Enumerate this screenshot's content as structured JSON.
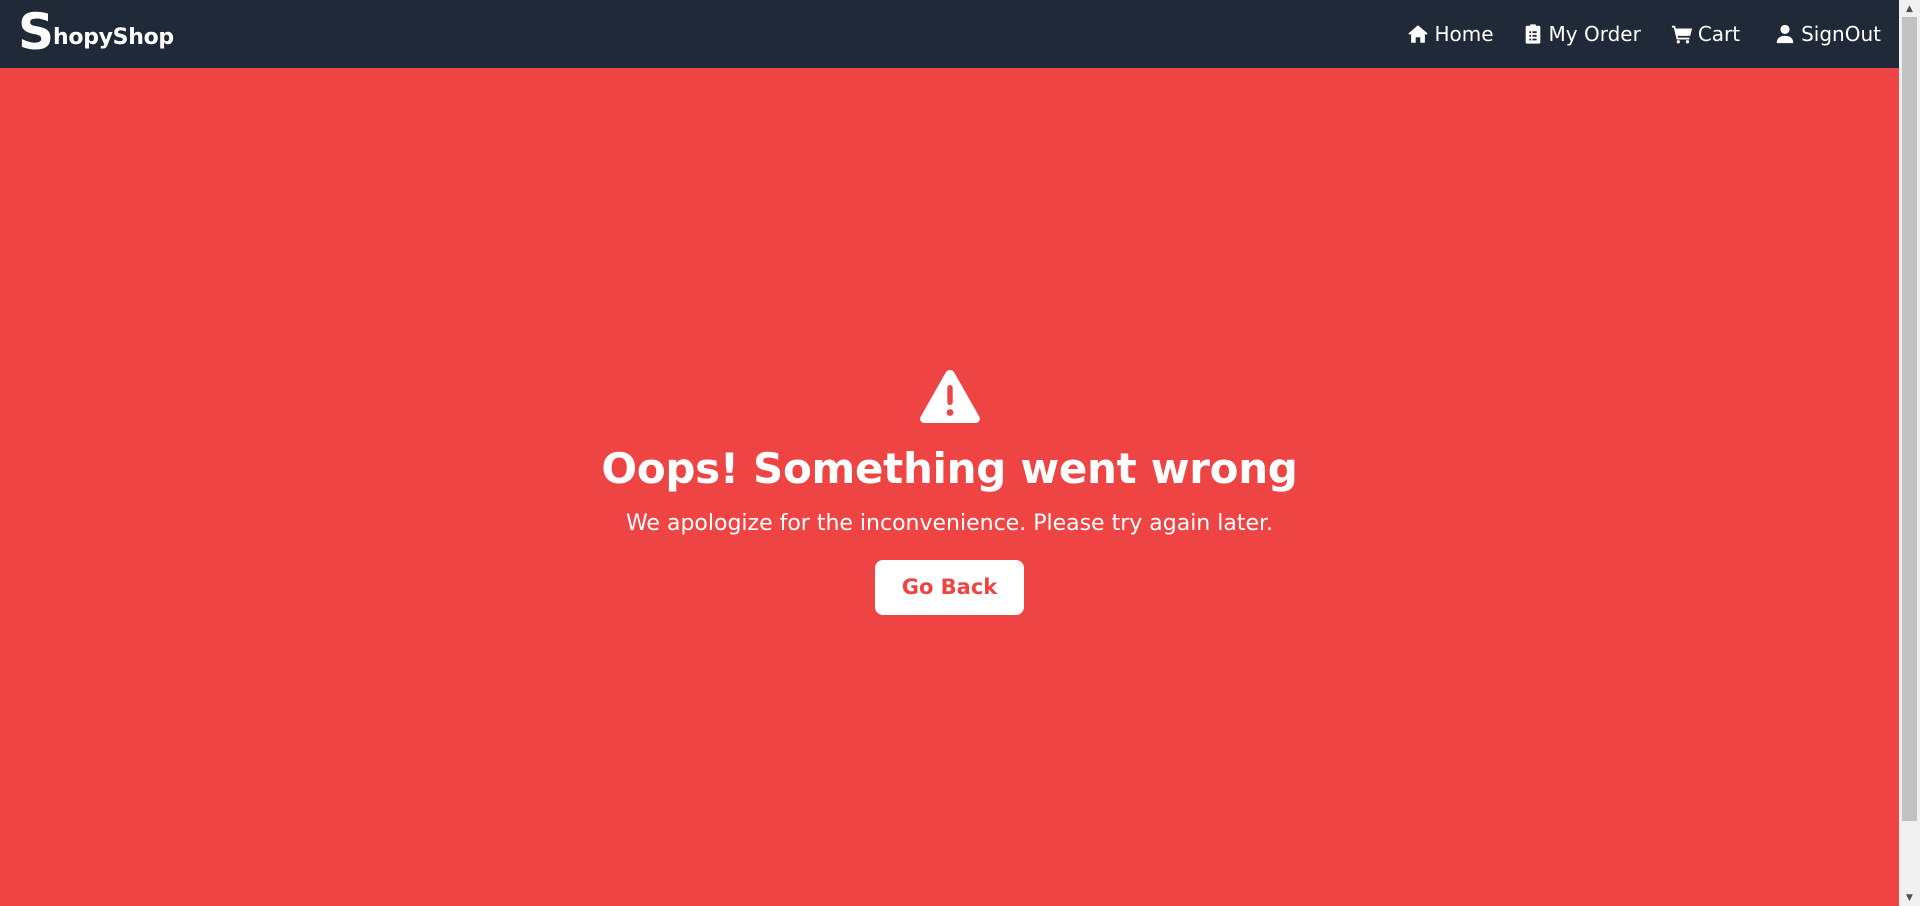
{
  "navbar": {
    "brand": {
      "initial": "S",
      "rest": "hopyShop"
    },
    "links": [
      {
        "label": "Home",
        "icon": "home-icon"
      },
      {
        "label": "My Order",
        "icon": "clipboard-icon"
      },
      {
        "label": "Cart",
        "icon": "cart-icon"
      },
      {
        "label": "SignOut",
        "icon": "user-icon"
      }
    ]
  },
  "error": {
    "icon": "warning-icon",
    "title": "Oops! Something went wrong",
    "message": "We apologize for the inconvenience. Please try again later.",
    "button_label": "Go Back"
  },
  "colors": {
    "navbar_bg": "#1f2937",
    "page_bg": "#ef4444",
    "text": "#ffffff",
    "button_bg": "#ffffff",
    "button_text": "#ef4444"
  }
}
